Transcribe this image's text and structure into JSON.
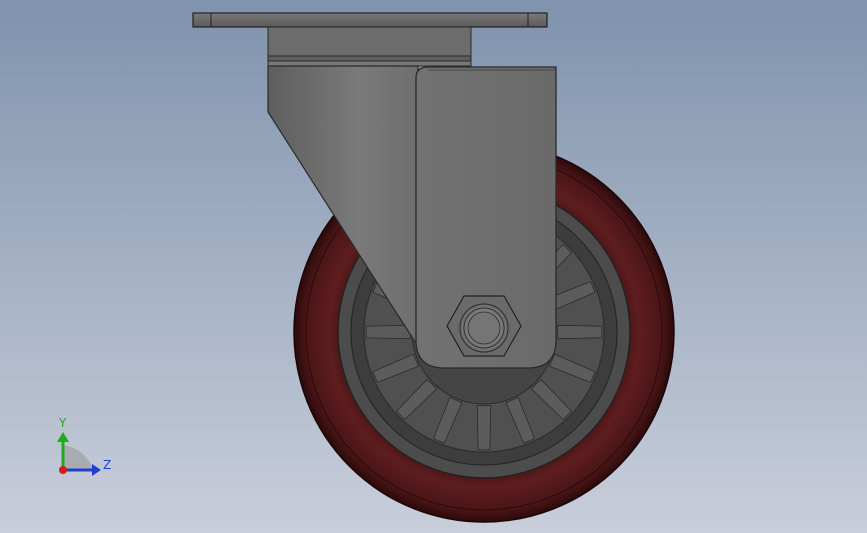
{
  "viewport": {
    "background_top_color": "#7f93ad",
    "background_bottom_color": "#c9cedb"
  },
  "model": {
    "name": "swivel caster",
    "tire_color": "#5a1c1c",
    "tire_dark_color": "#3b0f10",
    "hub_color": "#4a4a4a",
    "bracket_color": "#707070",
    "plate_color": "#6b6b6b"
  },
  "triad": {
    "y_label": "Y",
    "z_label": "Z",
    "y_color": "#1faa1f",
    "z_color": "#1e3fd0",
    "x_color": "#d01e1e"
  }
}
